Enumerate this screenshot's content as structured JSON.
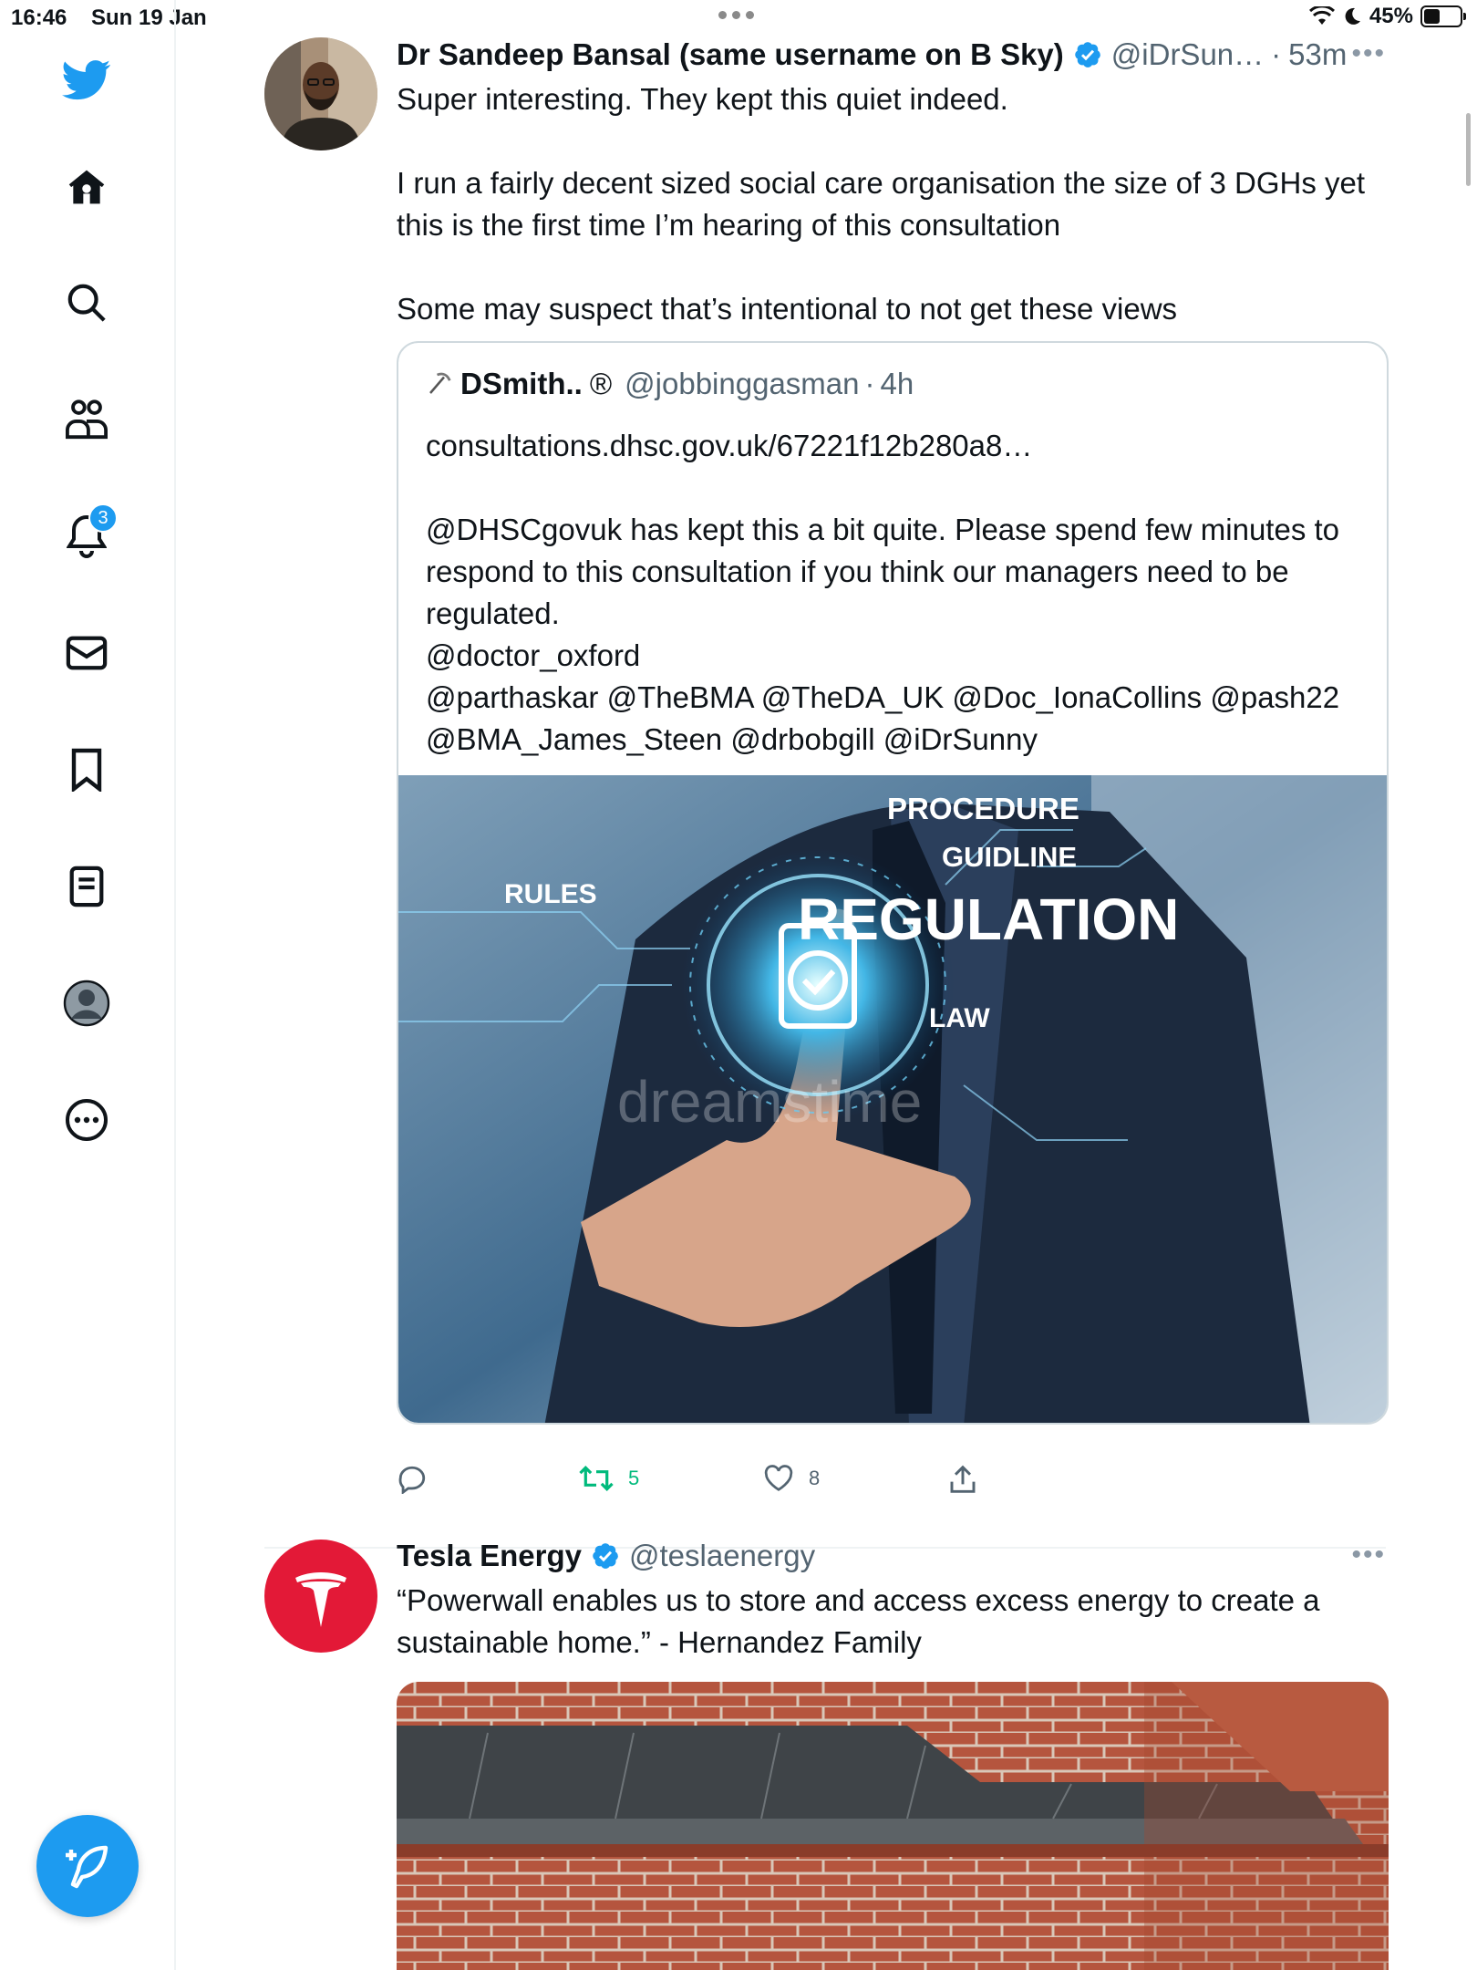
{
  "status_bar": {
    "time": "16:46",
    "date": "Sun 19 Jan",
    "battery": "45%",
    "battery_level": 0.45
  },
  "sidebar": {
    "items": [
      {
        "icon": "twitter-logo-icon"
      },
      {
        "icon": "home-icon"
      },
      {
        "icon": "search-icon"
      },
      {
        "icon": "communities-icon"
      },
      {
        "icon": "notifications-icon",
        "badge": "3"
      },
      {
        "icon": "messages-icon"
      },
      {
        "icon": "bookmarks-icon"
      },
      {
        "icon": "lists-icon"
      },
      {
        "icon": "profile-icon"
      },
      {
        "icon": "more-icon"
      }
    ],
    "compose_icon": "compose-icon"
  },
  "tweets": [
    {
      "name": "Dr Sandeep Bansal (same username on B Sky)",
      "handle": "@iDrSun…",
      "dot": "·",
      "time": "53m",
      "body": "Super interesting. They kept this quiet indeed.\n\nI run a fairly decent sized social care organisation the size of 3 DGHs yet this is the first time I’m hearing of this consultation\n\nSome may suspect that’s intentional to not get these views",
      "quote": {
        "name": "DSmith..",
        "reg": "®",
        "handle": "@jobbinggasman",
        "dot": "·",
        "time": "4h",
        "body": "consultations.dhsc.gov.uk/67221f12b280a8…\n\n@DHSCgovuk has kept this a bit quite. Please spend few minutes to respond to this consultation if you think our managers need to be regulated.\n@doctor_oxford\n@parthaskar @TheBMA @TheDA_UK @Doc_IonaCollins @pash22\n@BMA_James_Steen @drbobgill @iDrSunny",
        "image": {
          "procedure": "PROCEDURE",
          "guidline": "GUIDLINE",
          "rules": "RULES",
          "regulation": "REGULATION",
          "law": "LAW",
          "watermark": "dreamstime"
        }
      },
      "retweets": "5",
      "likes": "8"
    },
    {
      "name": "Tesla Energy",
      "handle": "@teslaenergy",
      "body": "“Powerwall enables us to store and access excess energy to create a sustainable home.” - Hernandez Family"
    }
  ],
  "colors": {
    "accent": "#1d9bf0",
    "retweet": "#00ba7c",
    "tesla_red": "#e31937",
    "text_secondary": "#536471"
  }
}
